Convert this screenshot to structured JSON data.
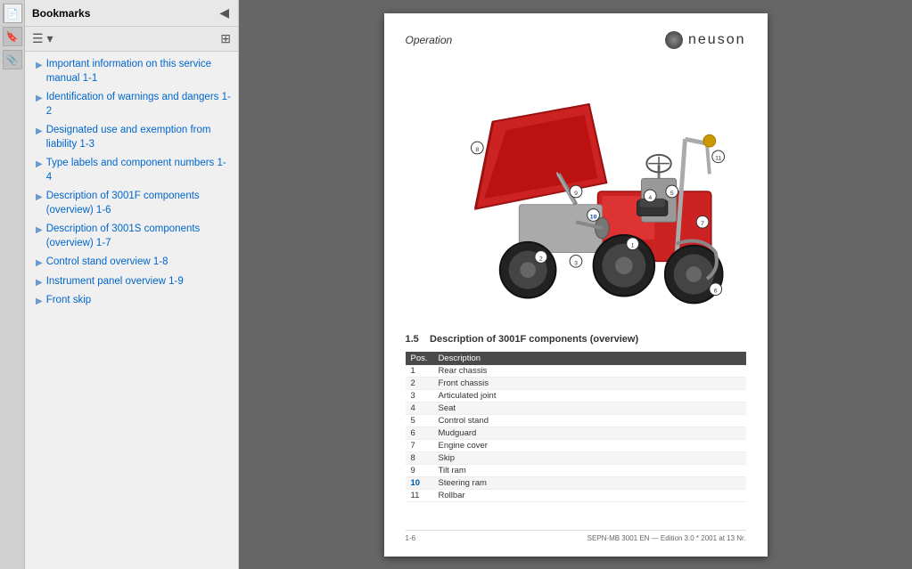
{
  "sidebar": {
    "title": "Bookmarks",
    "items": [
      {
        "id": "item-1",
        "text": "Important information on this service manual 1-1"
      },
      {
        "id": "item-2",
        "text": "Identification of warnings and dangers 1-2"
      },
      {
        "id": "item-3",
        "text": "Designated use and exemption from liability 1-3"
      },
      {
        "id": "item-4",
        "text": "Type labels and component numbers 1-4"
      },
      {
        "id": "item-5",
        "text": "Description of 3001F components (overview) 1-6"
      },
      {
        "id": "item-6",
        "text": "Description of 3001S components (overview) 1-7"
      },
      {
        "id": "item-7",
        "text": "Control stand overview 1-8"
      },
      {
        "id": "item-8",
        "text": "Instrument panel overview 1-9"
      },
      {
        "id": "item-9",
        "text": "Front skip"
      }
    ]
  },
  "page": {
    "header_title": "Operation",
    "brand": "neuson",
    "section_number": "1.5",
    "section_title": "Description of 3001F components (overview)",
    "table_headers": [
      "Pos.",
      "Description"
    ],
    "table_rows": [
      {
        "pos": "1",
        "desc": "Rear chassis",
        "highlighted": false
      },
      {
        "pos": "2",
        "desc": "Front chassis",
        "highlighted": false
      },
      {
        "pos": "3",
        "desc": "Articulated joint",
        "highlighted": false
      },
      {
        "pos": "4",
        "desc": "Seat",
        "highlighted": false
      },
      {
        "pos": "5",
        "desc": "Control stand",
        "highlighted": false
      },
      {
        "pos": "6",
        "desc": "Mudguard",
        "highlighted": false
      },
      {
        "pos": "7",
        "desc": "Engine cover",
        "highlighted": false
      },
      {
        "pos": "8",
        "desc": "Skip",
        "highlighted": false
      },
      {
        "pos": "9",
        "desc": "Tilt ram",
        "highlighted": false
      },
      {
        "pos": "10",
        "desc": "Steering ram",
        "highlighted": true
      },
      {
        "pos": "11",
        "desc": "Rollbar",
        "highlighted": false
      }
    ],
    "footer_left": "1-6",
    "footer_right": "SEPN-MB 3001 EN — Edition 3.0 * 2001 at 13 Nr."
  },
  "icons": {
    "bookmark": "🔖",
    "panel_toggle": "◀",
    "list_view": "☰",
    "expand": "⊞",
    "attachment": "📎",
    "page_icon": "📄"
  }
}
